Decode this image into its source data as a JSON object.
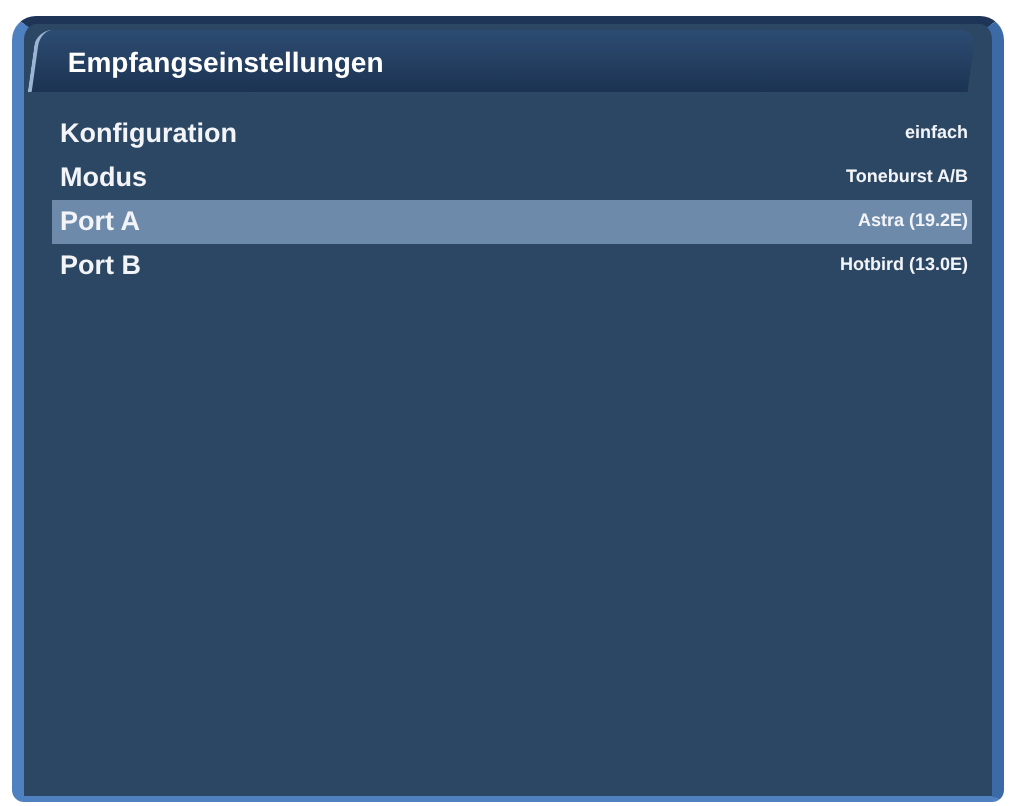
{
  "window": {
    "title": "Empfangseinstellungen"
  },
  "settings": [
    {
      "label": "Konfiguration",
      "value": "einfach",
      "selected": false
    },
    {
      "label": "Modus",
      "value": "Toneburst A/B",
      "selected": false
    },
    {
      "label": "Port A",
      "value": "Astra (19.2E)",
      "selected": true
    },
    {
      "label": "Port B",
      "value": "Hotbird (13.0E)",
      "selected": false
    }
  ]
}
